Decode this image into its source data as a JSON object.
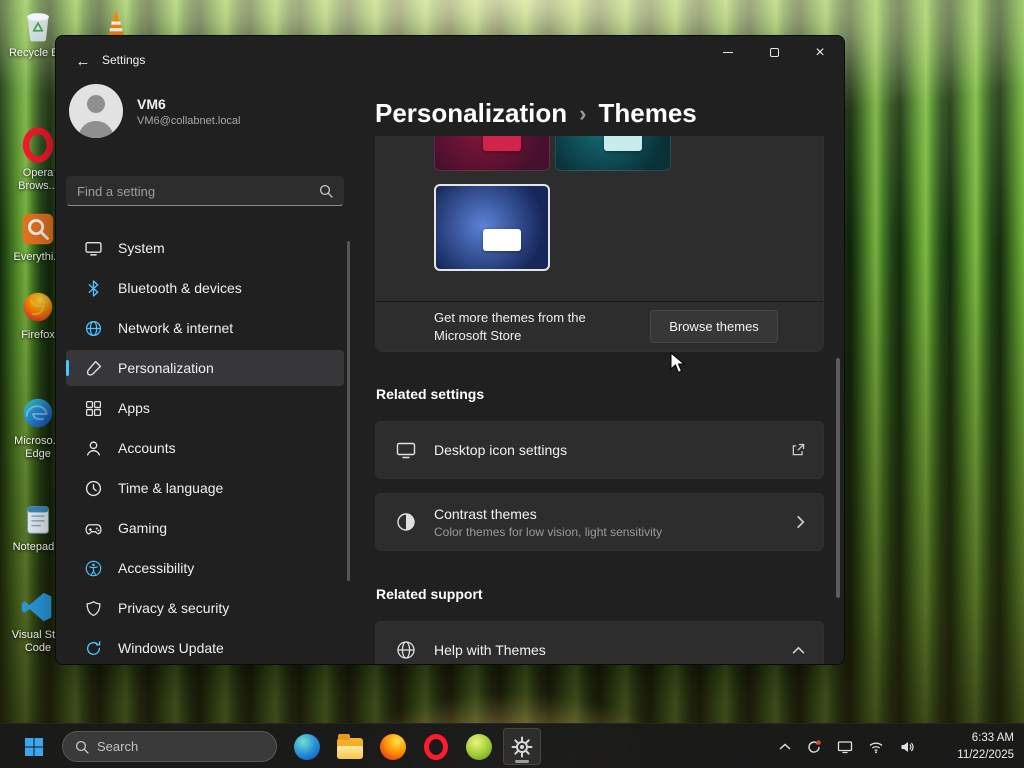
{
  "accent_color": "#4cc2ff",
  "desktop": {
    "icons": [
      {
        "icon": "recycle-bin",
        "label": "Recycle Bin"
      },
      {
        "icon": "vlc",
        "label": ""
      },
      {
        "icon": "opera",
        "label": "Opera Brows..."
      },
      {
        "icon": "everything",
        "label": "Everythi..."
      },
      {
        "icon": "firefox",
        "label": "Firefox"
      },
      {
        "icon": "edge",
        "label": "Microso... Edge"
      },
      {
        "icon": "notepad",
        "label": "Notepad..."
      },
      {
        "icon": "vscode",
        "label": "Visual St... Code"
      }
    ]
  },
  "window": {
    "title": "Settings",
    "controls": [
      "minimize",
      "maximize",
      "close"
    ],
    "user": {
      "name": "VM6",
      "email": "VM6@collabnet.local"
    },
    "search_placeholder": "Find a setting",
    "nav": [
      {
        "icon": "system",
        "label": "System",
        "selected": false
      },
      {
        "icon": "bluetooth",
        "label": "Bluetooth & devices",
        "selected": false
      },
      {
        "icon": "network",
        "label": "Network & internet",
        "selected": false
      },
      {
        "icon": "personalization",
        "label": "Personalization",
        "selected": true
      },
      {
        "icon": "apps",
        "label": "Apps",
        "selected": false
      },
      {
        "icon": "accounts",
        "label": "Accounts",
        "selected": false
      },
      {
        "icon": "time",
        "label": "Time & language",
        "selected": false
      },
      {
        "icon": "gaming",
        "label": "Gaming",
        "selected": false
      },
      {
        "icon": "accessibility",
        "label": "Accessibility",
        "selected": false
      },
      {
        "icon": "privacy",
        "label": "Privacy & security",
        "selected": false
      },
      {
        "icon": "update",
        "label": "Windows Update",
        "selected": false
      }
    ]
  },
  "main": {
    "breadcrumb": {
      "parent": "Personalization",
      "separator": "›",
      "current": "Themes"
    },
    "themes": [
      {
        "bg1": "#46102e",
        "bg2": "#8a1538",
        "accent": "#d2234a",
        "selected": false
      },
      {
        "bg1": "#0a3038",
        "bg2": "#17707a",
        "accent": "#c8ecee",
        "selected": false
      },
      {
        "bg1": "#16275a",
        "bg2": "#5b82d8",
        "accent": "#ffffff",
        "selected": true
      }
    ],
    "themes_card": {
      "store_text": "Get more themes from the Microsoft Store",
      "browse_button": "Browse themes"
    },
    "related_settings": {
      "heading": "Related settings",
      "items": [
        {
          "icon": "desktop-icons",
          "title": "Desktop icon settings",
          "subtitle": "",
          "trailing": "external-link"
        },
        {
          "icon": "contrast",
          "title": "Contrast themes",
          "subtitle": "Color themes for low vision, light sensitivity",
          "trailing": "chevron-right"
        }
      ]
    },
    "related_support": {
      "heading": "Related support",
      "items": [
        {
          "icon": "help-globe",
          "title": "Help with Themes",
          "subtitle": "",
          "trailing": "chevron-up"
        }
      ]
    }
  },
  "taskbar": {
    "search_placeholder": "Search",
    "apps": [
      {
        "icon": "edge",
        "active": false
      },
      {
        "icon": "file-explorer",
        "active": false
      },
      {
        "icon": "firefox",
        "active": false
      },
      {
        "icon": "opera",
        "active": false
      },
      {
        "icon": "green-app",
        "active": false
      },
      {
        "icon": "settings",
        "active": true
      }
    ],
    "tray_icons": [
      "chevron-up",
      "sync",
      "display",
      "network",
      "volume"
    ],
    "time": "6:33 AM",
    "date": "11/22/2025"
  }
}
